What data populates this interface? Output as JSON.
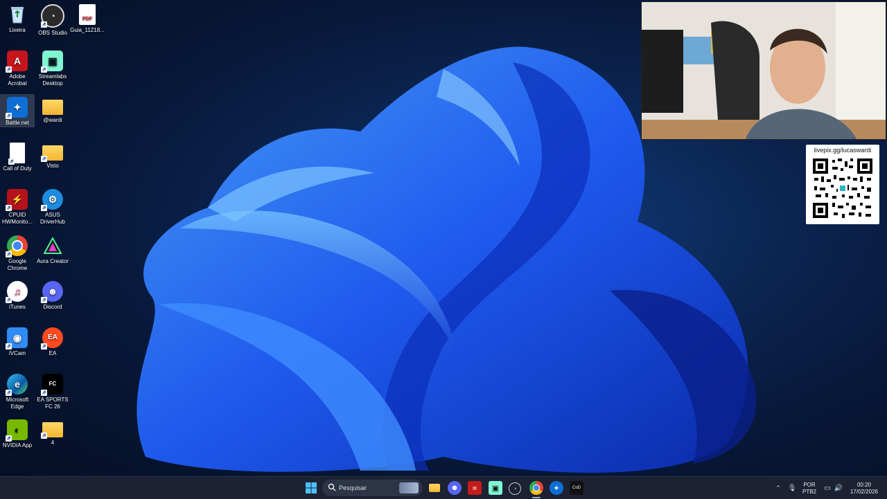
{
  "desktop": {
    "icons": [
      {
        "label": "Lixeira",
        "icon": "recycle-bin-icon"
      },
      {
        "label": "OBS Studio",
        "icon": "obs-icon"
      },
      {
        "label": "Guia_11218...",
        "icon": "pdf-file-icon"
      },
      {
        "label": "Adobe Acrobat",
        "icon": "acrobat-icon"
      },
      {
        "label": "Streamlabs Desktop",
        "icon": "streamlabs-icon"
      },
      {
        "label": "Battle.net",
        "icon": "battlenet-icon"
      },
      {
        "label": "@wardi",
        "icon": "folder-icon"
      },
      {
        "label": "Call of Duty",
        "icon": "file-icon"
      },
      {
        "label": "Visto",
        "icon": "folder-icon"
      },
      {
        "label": "CPUID HWMonito...",
        "icon": "hwmonitor-icon"
      },
      {
        "label": "ASUS DriverHub",
        "icon": "asus-driverhub-icon"
      },
      {
        "label": "Google Chrome",
        "icon": "chrome-icon"
      },
      {
        "label": "Aura Creator",
        "icon": "aura-creator-icon"
      },
      {
        "label": "iTunes",
        "icon": "itunes-icon"
      },
      {
        "label": "Discord",
        "icon": "discord-icon"
      },
      {
        "label": "iVCam",
        "icon": "ivcam-icon"
      },
      {
        "label": "EA",
        "icon": "ea-icon"
      },
      {
        "label": "Microsoft Edge",
        "icon": "edge-icon"
      },
      {
        "label": "EA SPORTS FC 26",
        "icon": "fc26-icon"
      },
      {
        "label": "NVIDIA App",
        "icon": "nvidia-icon"
      },
      {
        "label": "4",
        "icon": "folder-icon"
      }
    ]
  },
  "overlay": {
    "qr_label": "livepix.gg/lucaswardi"
  },
  "taskbar": {
    "search_placeholder": "Pesquisar",
    "language": "POR",
    "keyboard": "PTB2",
    "time": "00:20",
    "date": "17/02/2026"
  },
  "colors": {
    "accent": "#1e6bff",
    "taskbar": "#1c2233"
  }
}
